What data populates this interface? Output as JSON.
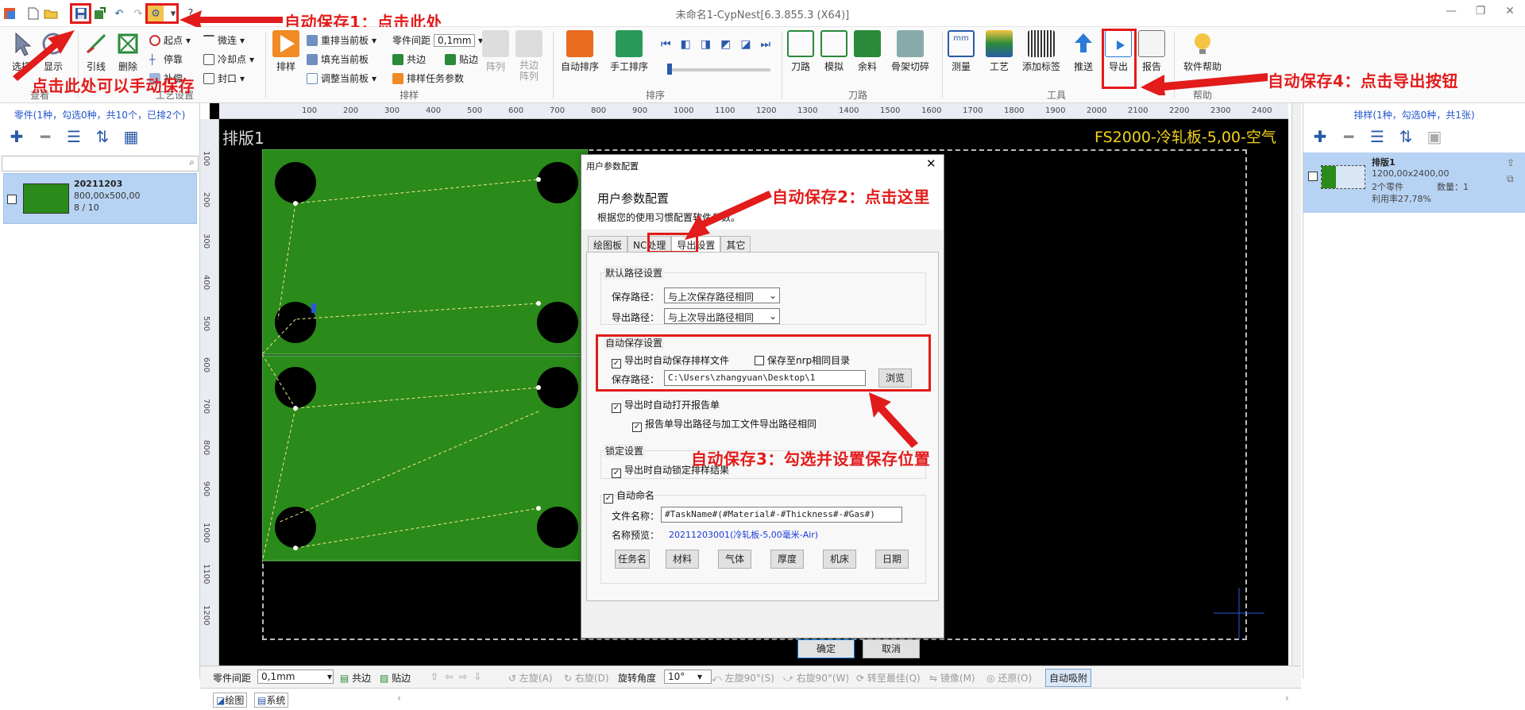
{
  "window": {
    "title": "未命名1-CypNest[6.3.855.3 (X64)]"
  },
  "ribbon": {
    "groups": {
      "view": "查看",
      "craft": "工艺设置",
      "nest": "排样",
      "sort": "排序",
      "toolpath": "刀路",
      "tools": "工具",
      "help": "帮助"
    },
    "select": "选择",
    "display": "显示",
    "leadline": "引线",
    "delete": "删除",
    "start_point": "起点",
    "micro_joint": "微连",
    "stop_point": "停靠",
    "cooling_point": "冷却点",
    "close": "封口",
    "compensate": "补偿",
    "nest": "排样",
    "renest": "重排当前板",
    "fill": "填充当前板",
    "adjust": "调整当前板",
    "part_gap_label": "零件间距",
    "part_gap_value": "0,1mm",
    "common_edge": "共边",
    "stick_edge": "贴边",
    "nest_params": "排样任务参数",
    "array": "阵列",
    "common_array": "共边阵列",
    "auto_sort": "自动排序",
    "manual_sort": "手工排序",
    "toolpath": "刀路",
    "simulate": "模拟",
    "remnant": "余料",
    "frame_cut": "骨架切碎",
    "measure": "测量",
    "craft": "工艺",
    "add_label": "添加标签",
    "push": "推送",
    "export": "导出",
    "report": "报告",
    "software_help": "软件帮助"
  },
  "annotations": {
    "a1": "自动保存1：点击此处",
    "a_manual": "点击此处可以手动保存",
    "a2": "自动保存2：点击这里",
    "a3": "自动保存3：勾选并设置保存位置",
    "a4": "自动保存4：点击导出按钮"
  },
  "left_panel": {
    "header": "零件(1种，勾选0种，共10个，已排2个)",
    "part": {
      "name": "20211203",
      "size": "800,00x500,00",
      "count": "8 / 10"
    }
  },
  "canvas": {
    "sheet_label": "排版1",
    "material_label": "FS2000-冷轧板-5,00-空气",
    "ruler_top": [
      "100",
      "200",
      "300",
      "400",
      "500",
      "600",
      "700",
      "800",
      "900",
      "1000",
      "1100",
      "1200",
      "1300",
      "1400",
      "1500",
      "1600",
      "1700",
      "1800",
      "1900",
      "2000",
      "2100",
      "2200",
      "2300",
      "2400"
    ],
    "ruler_left": [
      "100",
      "200",
      "300",
      "400",
      "500",
      "600",
      "700",
      "800",
      "900",
      "1000",
      "1100",
      "1200"
    ]
  },
  "dialog": {
    "title": "用户参数配置",
    "heading": "用户参数配置",
    "subheading": "根据您的使用习惯配置软件参数。",
    "tabs": [
      "绘图板",
      "NC处理",
      "导出设置",
      "其它"
    ],
    "default_path": {
      "legend": "默认路径设置",
      "save_label": "保存路径：",
      "save_value": "与上次保存路径相同",
      "export_label": "导出路径：",
      "export_value": "与上次导出路径相同"
    },
    "autosave": {
      "legend": "自动保存设置",
      "auto_save_on_export": "导出时自动保存排样文件",
      "save_to_nrp_dir": "保存至nrp相同目录",
      "path_label": "保存路径：",
      "path_value": "C:\\Users\\zhangyuan\\Desktop\\1",
      "browse": "浏览"
    },
    "open_report": "导出时自动打开报告单",
    "report_same_path": "报告单导出路径与加工文件导出路径相同",
    "lock": {
      "legend": "锁定设置",
      "auto_lock": "导出时自动锁定排样结果"
    },
    "auto_name": {
      "legend": "自动命名",
      "file_label": "文件名称：",
      "file_value": "#TaskName#(#Material#-#Thickness#-#Gas#)",
      "preview_label": "名称预览：",
      "preview_value": "20211203001(冷轧板-5,00毫米-Air)",
      "buttons": [
        "任务名",
        "材料",
        "气体",
        "厚度",
        "机床",
        "日期"
      ]
    },
    "ok": "确定",
    "cancel": "取消"
  },
  "right_panel": {
    "header": "排样(1种，勾选0种，共1张)",
    "sheet": {
      "name": "排版1",
      "size": "1200,00x2400,00",
      "parts": "2个零件",
      "qty": "数量：1",
      "utilization": "利用率27,78%"
    }
  },
  "bottom_bar": {
    "part_gap_label": "零件间距",
    "part_gap_value": "0,1mm",
    "common_edge": "共边",
    "stick_edge": "贴边",
    "rotate_left": "左旋(A)",
    "rotate_right": "右旋(D)",
    "rotate_angle_label": "旋转角度",
    "rotate_angle_value": "10°",
    "left90": "左旋90°(S)",
    "right90": "右旋90°(W)",
    "best": "转至最佳(Q)",
    "mirror": "镜像(M)",
    "restore": "还原(O)",
    "auto_snap": "自动吸附"
  },
  "status_bar": {
    "tab_draw": "绘图",
    "tab_system": "系统"
  },
  "colors": {
    "annotation_red": "#e21b1b",
    "sheet_green": "#2a8a1a",
    "material_yellow": "#f2d21a",
    "selection_blue": "#b7d3f3"
  }
}
